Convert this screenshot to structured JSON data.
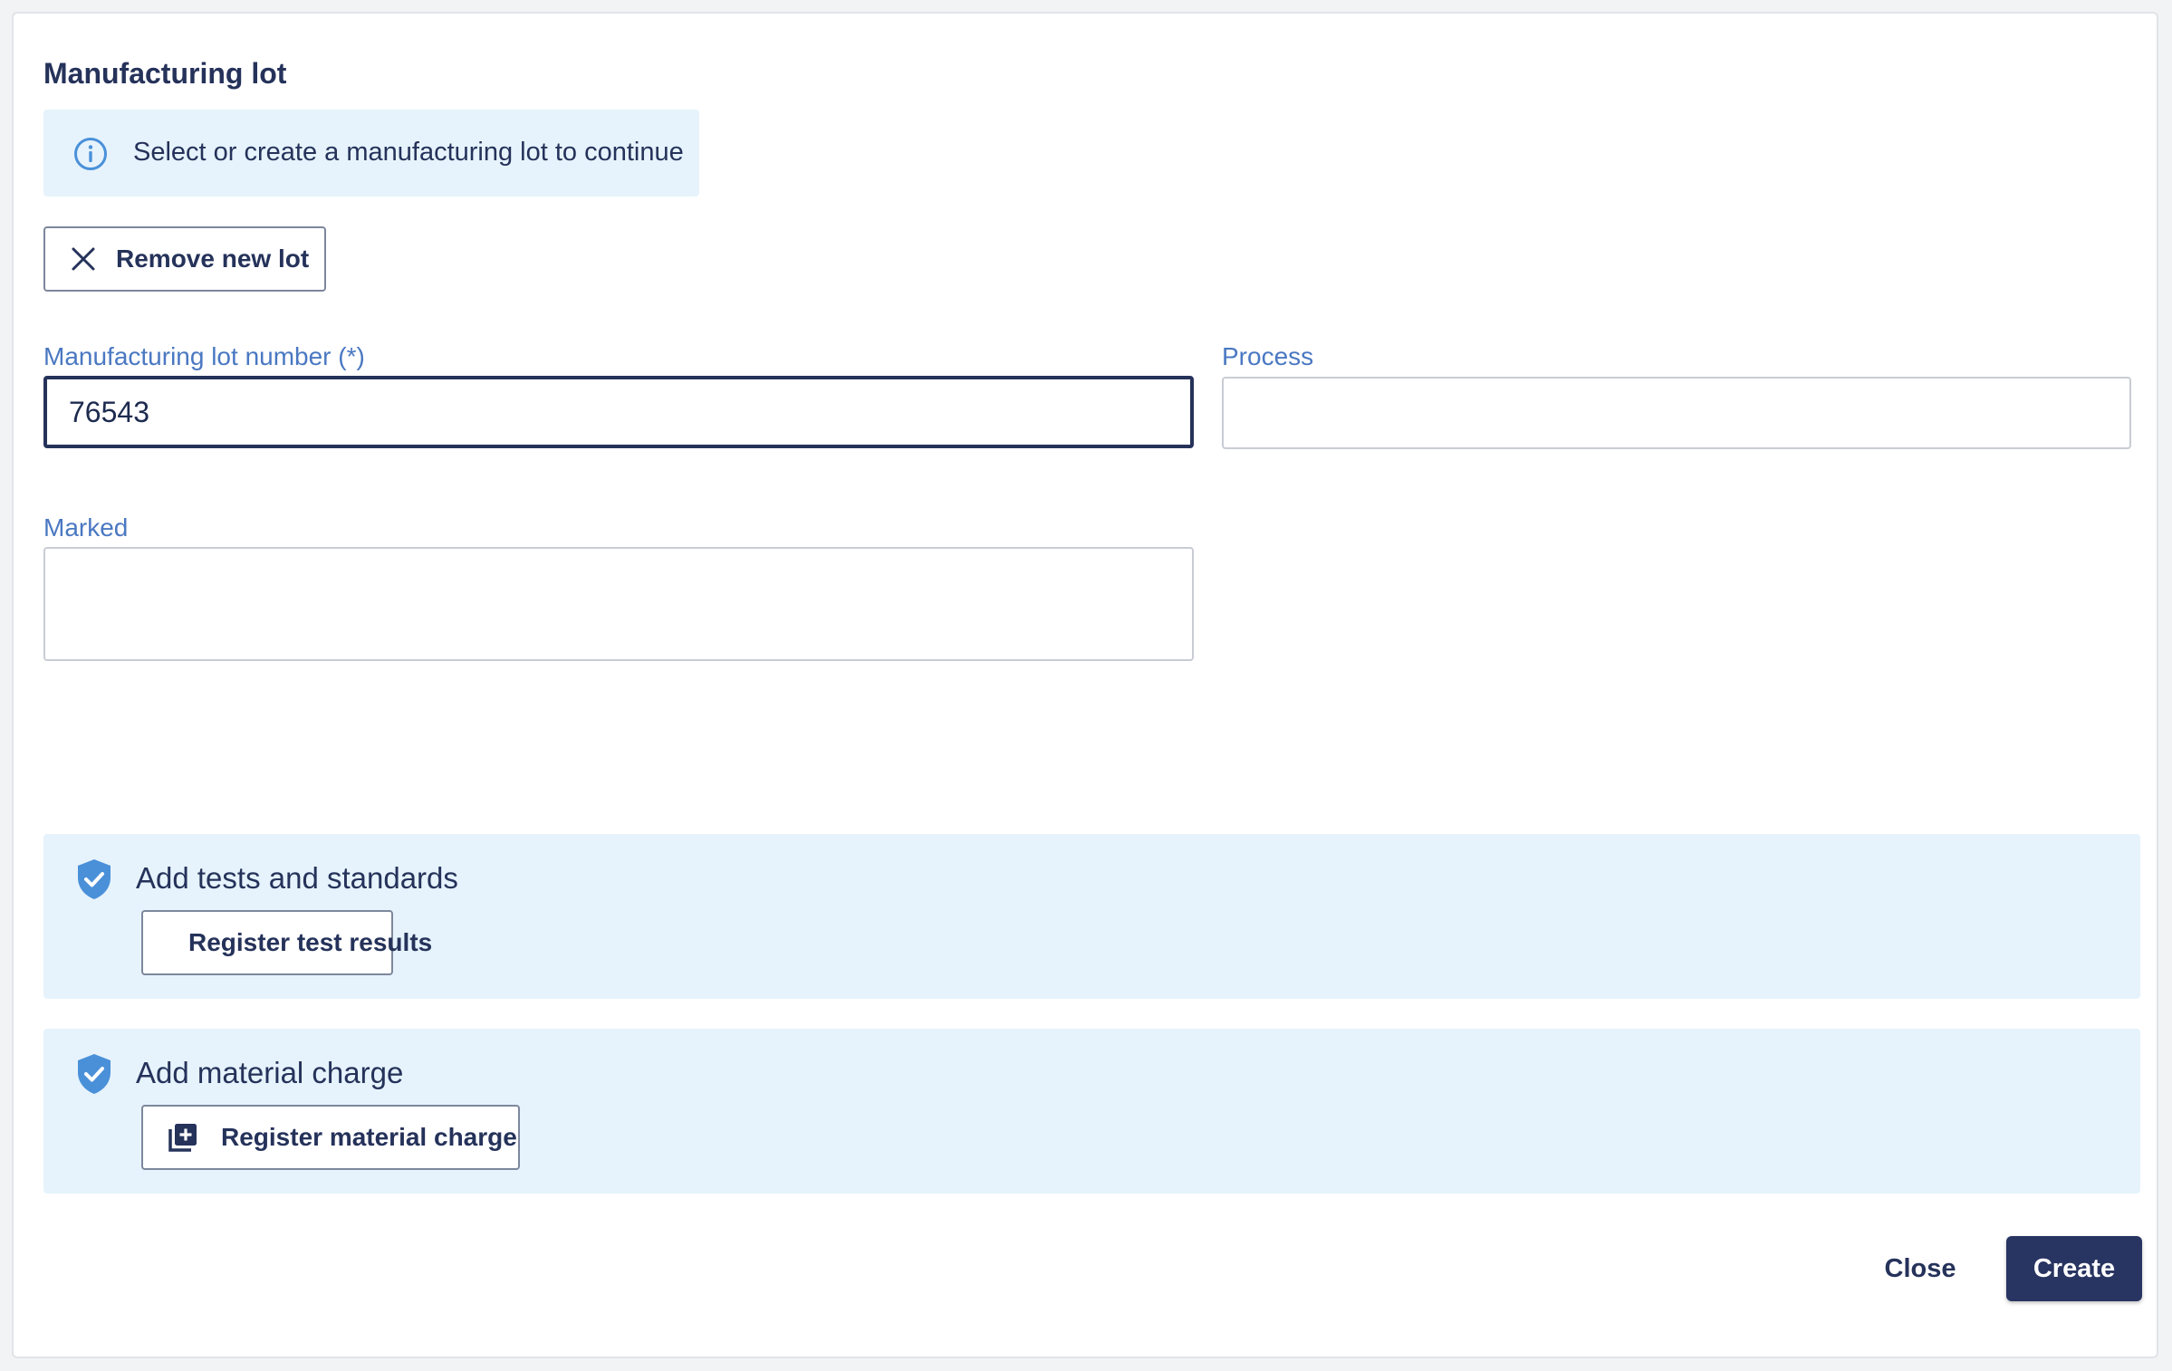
{
  "dialog": {
    "title": "Manufacturing lot",
    "info_message": "Select or create a manufacturing lot to continue",
    "info_icon": "info-circle-icon",
    "remove_button_label": "Remove new lot"
  },
  "form": {
    "lot_number": {
      "label": "Manufacturing lot number (*)",
      "value": "76543"
    },
    "process": {
      "label": "Process",
      "value": ""
    },
    "marked": {
      "label": "Marked",
      "value": ""
    }
  },
  "sections": [
    {
      "title": "Add tests and standards",
      "button_label": "Register test results",
      "icon": "shield-check-icon"
    },
    {
      "title": "Add material charge",
      "button_label": "Register material charge",
      "icon": "shield-check-icon"
    }
  ],
  "footer": {
    "close_label": "Close",
    "create_label": "Create"
  },
  "colors": {
    "primary": "#283461",
    "accent_blue": "#4a78c2",
    "info_bg": "#e6f3fc",
    "icon_blue": "#4a90d9"
  }
}
